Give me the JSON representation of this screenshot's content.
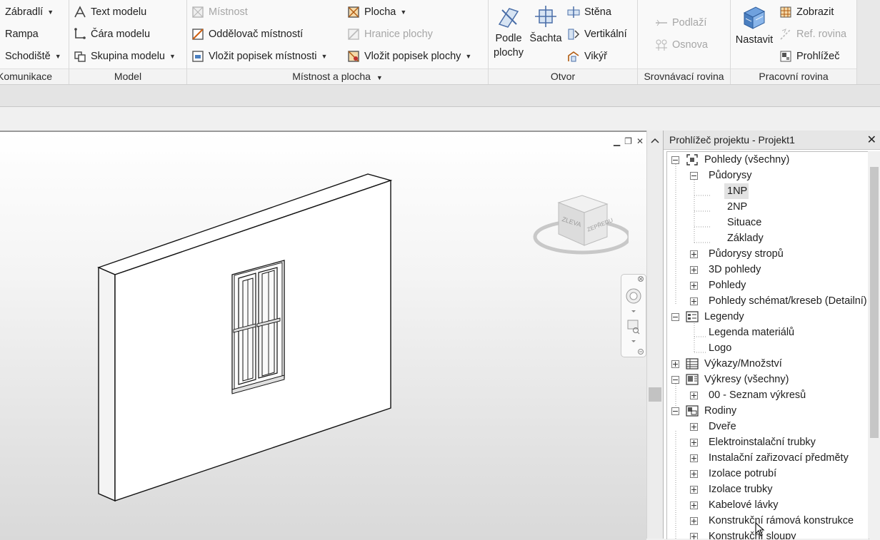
{
  "ribbon": {
    "panels": {
      "komunikace": {
        "title": "Komunikace",
        "zabradli": "Zábradlí",
        "rampa": "Rampa",
        "schodiste": "Schodiště"
      },
      "model": {
        "title": "Model",
        "text_modelu": "Text modelu",
        "cara_modelu": "Čára  modelu",
        "skupina_modelu": "Skupina modelu"
      },
      "mistnost": {
        "title": "Místnost a plocha",
        "mistnost": "Místnost",
        "oddelovac": "Oddělovač  místností",
        "popisek_mistnosti": "Vložit popisek  místnosti",
        "plocha": "Plocha",
        "hranice_plochy": "Hranice  plochy",
        "popisek_plochy": "Vložit popisek  plochy"
      },
      "otvor": {
        "title": "Otvor",
        "podle_plochy_1": "Podle",
        "podle_plochy_2": "plochy",
        "sachta": "Šachta",
        "stena": "Stěna",
        "vertikalni": "Vertikální",
        "vikyr": "Vikýř"
      },
      "srovnavaci": {
        "title": "Srovnávací rovina",
        "podlazi": "Podlaží",
        "osnova": "Osnova"
      },
      "pracovni": {
        "title": "Pracovní rovina",
        "nastavit": "Nastavit",
        "zobrazit": "Zobrazit",
        "ref_rovina": "Ref. rovina",
        "prohlizec": "Prohlížeč"
      }
    }
  },
  "viewcube": {
    "left_face": "ZLEVA",
    "front_face": "ZEPŘEDU"
  },
  "project_browser": {
    "title": "Prohlížeč projektu - Projekt1",
    "close": "✕",
    "items": [
      {
        "label": "Pohledy (všechny)"
      },
      {
        "label": "Půdorysy"
      },
      {
        "label": "1NP"
      },
      {
        "label": "2NP"
      },
      {
        "label": "Situace"
      },
      {
        "label": "Základy"
      },
      {
        "label": "Půdorysy stropů"
      },
      {
        "label": "3D pohledy"
      },
      {
        "label": "Pohledy"
      },
      {
        "label": "Pohledy schémat/kreseb (Detailní)"
      },
      {
        "label": "Legendy"
      },
      {
        "label": "Legenda materiálů"
      },
      {
        "label": "Logo"
      },
      {
        "label": "Výkazy/Množství"
      },
      {
        "label": "Výkresy (všechny)"
      },
      {
        "label": "00 - Seznam výkresů"
      },
      {
        "label": "Rodiny"
      },
      {
        "label": "Dveře"
      },
      {
        "label": "Elektroinstalační trubky"
      },
      {
        "label": "Instalační zařizovací předměty"
      },
      {
        "label": "Izolace potrubí"
      },
      {
        "label": "Izolace trubky"
      },
      {
        "label": "Kabelové lávky"
      },
      {
        "label": "Konstrukční rámová konstrukce"
      },
      {
        "label": "Konstrukční sloupy"
      }
    ]
  }
}
